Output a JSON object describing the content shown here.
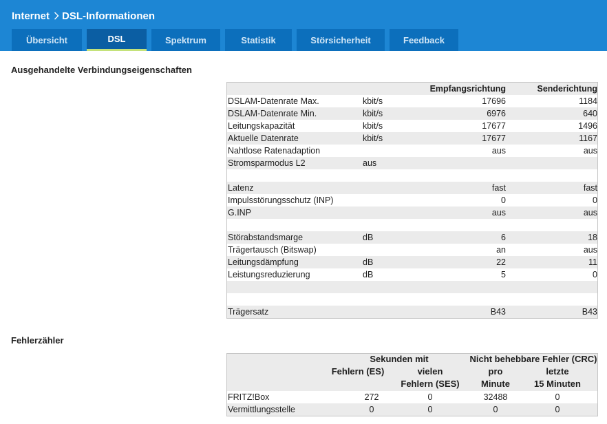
{
  "header": {
    "crumb_root": "Internet",
    "crumb_page": "DSL-Informationen",
    "tabs": [
      {
        "label": "Übersicht"
      },
      {
        "label": "DSL"
      },
      {
        "label": "Spektrum"
      },
      {
        "label": "Statistik"
      },
      {
        "label": "Störsicherheit"
      },
      {
        "label": "Feedback"
      }
    ],
    "active_tab": "DSL",
    "colors": {
      "bar": "#1d86d4",
      "tab": "#0c6fbc",
      "active_tab": "#0b5ea3",
      "active_underline": "#c4e27a"
    }
  },
  "connection": {
    "title": "Ausgehandelte Verbindungseigenschaften",
    "col_down": "Empfangsrichtung",
    "col_up": "Senderichtung",
    "rows": [
      {
        "label": "DSLAM-Datenrate Max.",
        "unit": "kbit/s",
        "down": "17696",
        "up": "1184"
      },
      {
        "label": "DSLAM-Datenrate Min.",
        "unit": "kbit/s",
        "down": "6976",
        "up": "640"
      },
      {
        "label": "Leitungskapazität",
        "unit": "kbit/s",
        "down": "17677",
        "up": "1496"
      },
      {
        "label": "Aktuelle Datenrate",
        "unit": "kbit/s",
        "down": "17677",
        "up": "1167"
      },
      {
        "label": "Nahtlose Ratenadaption",
        "unit": "",
        "down": "aus",
        "up": "aus"
      },
      {
        "label": "Stromsparmodus L2",
        "unit": "aus",
        "down": "",
        "up": ""
      },
      {
        "label": "",
        "unit": "",
        "down": "",
        "up": ""
      },
      {
        "label": "Latenz",
        "unit": "",
        "down": "fast",
        "up": "fast"
      },
      {
        "label": "Impulsstörungsschutz (INP)",
        "unit": "",
        "down": "0",
        "up": "0"
      },
      {
        "label": "G.INP",
        "unit": "",
        "down": "aus",
        "up": "aus"
      },
      {
        "label": "",
        "unit": "",
        "down": "",
        "up": ""
      },
      {
        "label": "Störabstandsmarge",
        "unit": "dB",
        "down": "6",
        "up": "18"
      },
      {
        "label": "Trägertausch (Bitswap)",
        "unit": "",
        "down": "an",
        "up": "aus"
      },
      {
        "label": "Leitungsdämpfung",
        "unit": "dB",
        "down": "22",
        "up": "11"
      },
      {
        "label": "Leistungsreduzierung",
        "unit": "dB",
        "down": "5",
        "up": "0"
      },
      {
        "label": "",
        "unit": "",
        "down": "",
        "up": ""
      },
      {
        "label": "",
        "unit": "",
        "down": "",
        "up": ""
      },
      {
        "label": "Trägersatz",
        "unit": "",
        "down": "B43",
        "up": "B43"
      }
    ]
  },
  "errors": {
    "title": "Fehlerzähler",
    "head_seconds": "Sekunden mit",
    "head_crc": "Nicht behebbare Fehler (CRC)",
    "head_es": "Fehlern (ES)",
    "head_ses_1": "vielen",
    "head_ses_2": "Fehlern (SES)",
    "head_crc1_1": "pro",
    "head_crc1_2": "Minute",
    "head_crc2_1": "letzte",
    "head_crc2_2": "15 Minuten",
    "rows": [
      {
        "label": "FRITZ!Box",
        "es": "272",
        "ses": "0",
        "crc_min": "32488",
        "crc_15": "0"
      },
      {
        "label": "Vermittlungsstelle",
        "es": "0",
        "ses": "0",
        "crc_min": "0",
        "crc_15": "0"
      }
    ]
  }
}
